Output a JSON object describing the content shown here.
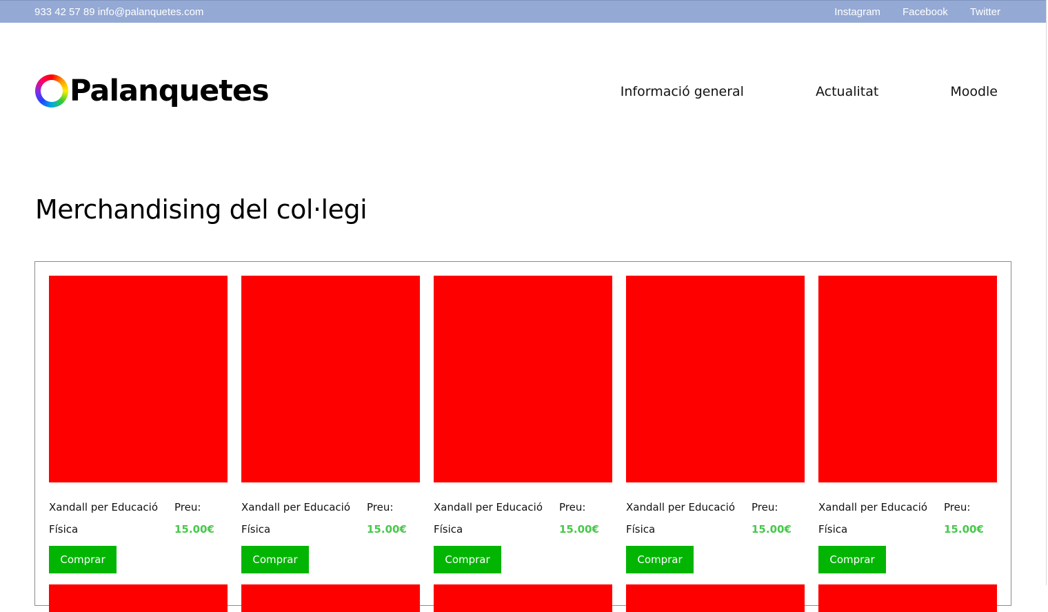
{
  "topbar": {
    "contact": "933 42 57 89 info@palanquetes.com",
    "social": [
      "Instagram",
      "Facebook",
      "Twitter"
    ]
  },
  "header": {
    "logo_text": "Palanquetes",
    "nav": [
      "Informació general",
      "Actualitat",
      "Moodle"
    ]
  },
  "main": {
    "title": "Merchandising del col·legi",
    "products": [
      {
        "name": "Xandall per Educació Física",
        "price_label": "Preu:",
        "price": "15.00€",
        "button": "Comprar"
      },
      {
        "name": "Xandall per Educació Física",
        "price_label": "Preu:",
        "price": "15.00€",
        "button": "Comprar"
      },
      {
        "name": "Xandall per Educació Física",
        "price_label": "Preu:",
        "price": "15.00€",
        "button": "Comprar"
      },
      {
        "name": "Xandall per Educació Física",
        "price_label": "Preu:",
        "price": "15.00€",
        "button": "Comprar"
      },
      {
        "name": "Xandall per Educació Física",
        "price_label": "Preu:",
        "price": "15.00€",
        "button": "Comprar"
      }
    ]
  },
  "colors": {
    "topbar": "#94a9d4",
    "product_image": "#ff0000",
    "price": "#47c84a",
    "button": "#03b503"
  },
  "icons": {
    "logo": "color-wheel-ring-icon"
  }
}
